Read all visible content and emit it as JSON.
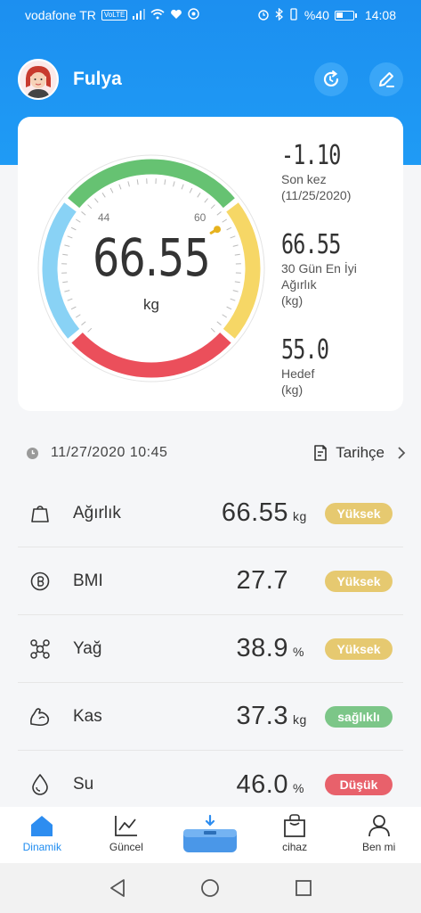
{
  "status_bar": {
    "carrier": "vodafone TR",
    "volte": "VoLTE",
    "battery": "%40",
    "time": "14:08"
  },
  "profile": {
    "name": "Fulya"
  },
  "gauge": {
    "value": "66.55",
    "unit": "kg",
    "tick_low": "44",
    "tick_high": "60",
    "pointer_fraction": 0.72
  },
  "stats": [
    {
      "value": "-1.10",
      "label_lines": [
        "Son kez",
        "(11/25/2020)"
      ]
    },
    {
      "value": "66.55",
      "label_lines": [
        "30 Gün En İyi",
        "Ağırlık",
        "(kg)"
      ]
    },
    {
      "value": "55.0",
      "label_lines": [
        "Hedef",
        "(kg)"
      ]
    }
  ],
  "measurement": {
    "datetime": "11/27/2020 10:45",
    "history_label": "Tarihçe"
  },
  "metrics": [
    {
      "name": "Ağırlık",
      "value": "66.55",
      "unit": "kg",
      "status": "Yüksek",
      "status_color": "#e6c970",
      "icon": "weight-icon"
    },
    {
      "name": "BMI",
      "value": "27.7",
      "unit": "",
      "status": "Yüksek",
      "status_color": "#e6c970",
      "icon": "bmi-icon"
    },
    {
      "name": "Yağ",
      "value": "38.9",
      "unit": "%",
      "status": "Yüksek",
      "status_color": "#e6c970",
      "icon": "fat-icon"
    },
    {
      "name": "Kas",
      "value": "37.3",
      "unit": "kg",
      "status": "sağlıklı",
      "status_color": "#7cc688",
      "icon": "muscle-icon"
    },
    {
      "name": "Su",
      "value": "46.0",
      "unit": "%",
      "status": "Düşük",
      "status_color": "#e8616b",
      "icon": "water-icon"
    }
  ],
  "nav": {
    "items": [
      {
        "label": "Dinamik",
        "icon": "home-icon",
        "active": true
      },
      {
        "label": "Güncel",
        "icon": "trend-chart-icon",
        "active": false
      },
      {
        "label": "",
        "icon": "scale-icon",
        "active": false
      },
      {
        "label": "cihaz",
        "icon": "bag-icon",
        "active": false
      },
      {
        "label": "Ben mi",
        "icon": "person-icon",
        "active": false
      }
    ]
  },
  "colors": {
    "header_blue": "#1f92f2",
    "gauge_green": "#66c272",
    "gauge_yellow": "#f6d766",
    "gauge_red": "#eb4f5b",
    "gauge_blue": "#89d2f5",
    "pointer": "#e6b21e"
  }
}
